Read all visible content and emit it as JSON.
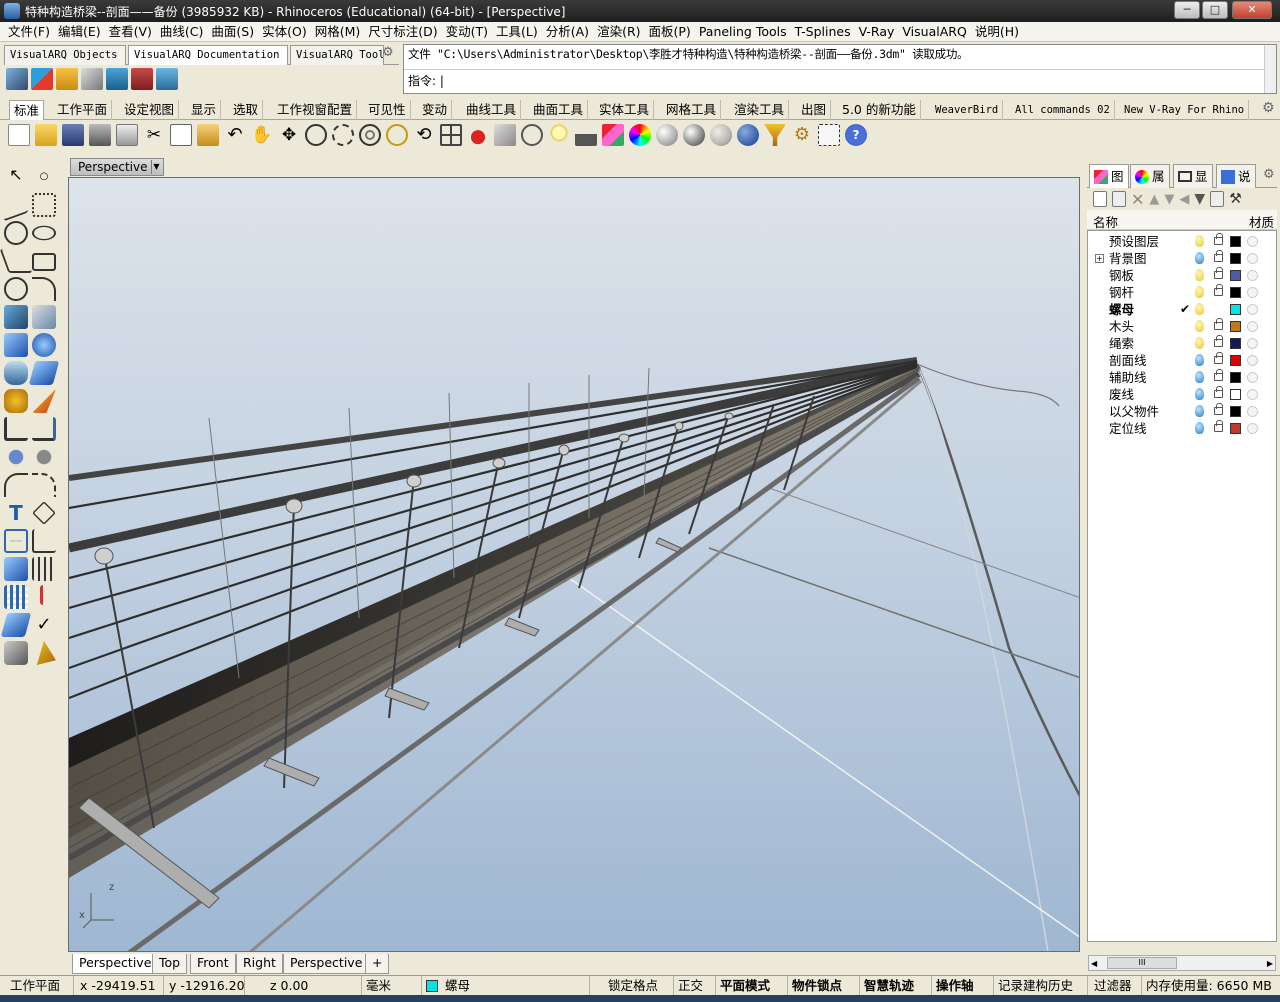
{
  "window": {
    "title": "特种构造桥梁--剖面——备份 (3985932 KB) - Rhinoceros (Educational) (64-bit) - [Perspective]",
    "buttons": {
      "minimize": "─",
      "maximize": "□",
      "close": "✕"
    }
  },
  "menu": [
    "文件(F)",
    "编辑(E)",
    "查看(V)",
    "曲线(C)",
    "曲面(S)",
    "实体(O)",
    "网格(M)",
    "尺寸标注(D)",
    "变动(T)",
    "工具(L)",
    "分析(A)",
    "渲染(R)",
    "面板(P)",
    "Paneling Tools",
    "T-Splines",
    "V-Ray",
    "VisualARQ",
    "说明(H)"
  ],
  "doc_tabs": [
    "VisualARQ Objects",
    "VisualARQ Documentation",
    "VisualARQ Tool"
  ],
  "command": {
    "history": "文件 \"C:\\Users\\Administrator\\Desktop\\李胜才特种构造\\特种构造桥梁--剖面——备份.3dm\" 读取成功。",
    "prompt": "指令:"
  },
  "toolbar_tabs": [
    "标准",
    "工作平面",
    "设定视图",
    "显示",
    "选取",
    "工作视窗配置",
    "可见性",
    "变动",
    "曲线工具",
    "曲面工具",
    "实体工具",
    "网格工具",
    "渲染工具",
    "出图",
    "5.0 的新功能",
    "WeaverBird",
    "All commands 02",
    "New V-Ray For Rhino"
  ],
  "std_tools": [
    "new-icon",
    "open-icon",
    "save-icon",
    "print-icon",
    "import-icon",
    "cut-icon",
    "copy-icon",
    "paste-icon",
    "undo-icon",
    "pan-icon",
    "rotate-view-icon",
    "zoom-icon",
    "zoom-window-icon",
    "zoom-extents-icon",
    "zoom-selected-icon",
    "rotate-icon",
    "four-viewports-icon",
    "car-icon",
    "properties-icon",
    "object-snap-icon",
    "lightbulb-icon",
    "lock-icon",
    "layer-icon",
    "color-wheel-icon",
    "shade-icon",
    "rendered-icon",
    "xray-icon",
    "render-sphere-icon",
    "filter-icon",
    "gear-icon",
    "grid-icon",
    "help-icon"
  ],
  "viewport": {
    "label": "Perspective"
  },
  "view_tabs": [
    "Perspective",
    "Top",
    "Front",
    "Right",
    "Perspective",
    "+"
  ],
  "panel": {
    "tabs": [
      "图",
      "属",
      "显",
      "说"
    ],
    "layers_header": {
      "name": "名称",
      "material": "材质"
    },
    "layers": [
      {
        "name": "预设图层",
        "on": true,
        "color": "#000000",
        "current": false
      },
      {
        "name": "背景图",
        "on": false,
        "color": "#000000",
        "current": false,
        "expand": "+"
      },
      {
        "name": "钢板",
        "on": true,
        "color": "#4e5aa6",
        "current": false
      },
      {
        "name": "钢杆",
        "on": true,
        "color": "#000000",
        "current": false
      },
      {
        "name": "螺母",
        "on": true,
        "color": "#00e5e5",
        "current": true,
        "check": "✔"
      },
      {
        "name": "木头",
        "on": true,
        "color": "#c17a12",
        "current": false
      },
      {
        "name": "绳索",
        "on": true,
        "color": "#111a5a",
        "current": false
      },
      {
        "name": "剖面线",
        "on": false,
        "color": "#e00000",
        "current": false
      },
      {
        "name": "辅助线",
        "on": false,
        "color": "#000000",
        "current": false
      },
      {
        "name": "废线",
        "on": false,
        "color": "#ffffff",
        "current": false
      },
      {
        "name": "以父物件",
        "on": false,
        "color": "#000000",
        "current": false
      },
      {
        "name": "定位线",
        "on": false,
        "color": "#c33a2a",
        "current": false
      }
    ],
    "scroll_grip": "III"
  },
  "status": {
    "cplane": "工作平面",
    "x": "x -29419.51",
    "y": "y -12916.20",
    "z": "z 0.00",
    "units": "毫米",
    "layer": "螺母",
    "layer_color": "#00e5e5",
    "lock_grid": "锁定格点",
    "ortho": "正交",
    "planar": "平面模式",
    "osnap": "物件锁点",
    "smarttrack": "智慧轨迹",
    "gumball": "操作轴",
    "history": "记录建构历史",
    "filter": "过滤器",
    "memory": "内存使用量: 6650 MB"
  },
  "axis": {
    "z": "z",
    "x": "x"
  },
  "colors": {
    "title_bar": "#2a2a2a",
    "sky_top": "#dde3ea",
    "sky_bottom": "#9fb7d2",
    "steel": "#3c3c3c"
  }
}
